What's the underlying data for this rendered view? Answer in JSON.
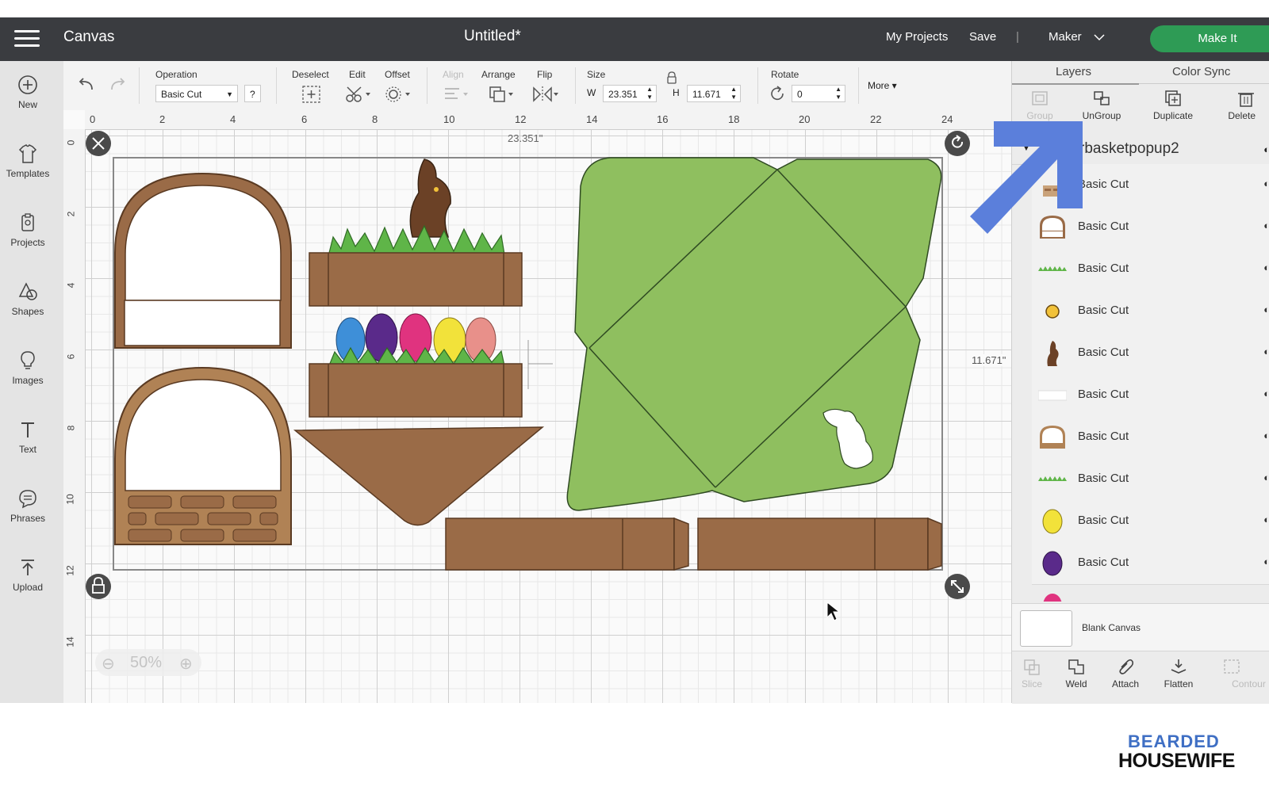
{
  "topbar": {
    "app_title": "Canvas",
    "doc_title": "Untitled*",
    "my_projects": "My Projects",
    "save": "Save",
    "separator": "|",
    "machine": "Maker",
    "make_it": "Make It"
  },
  "sidebar": {
    "items": [
      {
        "label": "New",
        "icon": "plus-circle-icon"
      },
      {
        "label": "Templates",
        "icon": "shirt-icon"
      },
      {
        "label": "Projects",
        "icon": "projects-icon"
      },
      {
        "label": "Shapes",
        "icon": "shapes-icon"
      },
      {
        "label": "Images",
        "icon": "lightbulb-icon"
      },
      {
        "label": "Text",
        "icon": "text-icon"
      },
      {
        "label": "Phrases",
        "icon": "speech-bubble-icon"
      },
      {
        "label": "Upload",
        "icon": "upload-icon"
      }
    ]
  },
  "toolbar": {
    "operation_label": "Operation",
    "operation_value": "Basic Cut",
    "help": "?",
    "deselect": "Deselect",
    "edit": "Edit",
    "offset": "Offset",
    "align": "Align",
    "arrange": "Arrange",
    "flip": "Flip",
    "size": "Size",
    "w_label": "W",
    "w_value": "23.351",
    "h_label": "H",
    "h_value": "11.671",
    "rotate": "Rotate",
    "rotate_value": "0",
    "more": "More ▾"
  },
  "canvas": {
    "ruler_top": [
      "0",
      "2",
      "4",
      "6",
      "8",
      "10",
      "12",
      "14",
      "16",
      "18",
      "20",
      "22",
      "24"
    ],
    "ruler_left": [
      "0",
      "2",
      "4",
      "6",
      "8",
      "10",
      "12",
      "14"
    ],
    "width_readout": "23.351\"",
    "height_readout": "11.671\"",
    "zoom": "50%",
    "colors": {
      "brown": "#9a6b47",
      "dark_brown": "#5a3a22",
      "tan": "#b08255",
      "green": "#8fbf5f",
      "grass": "#5fb548",
      "egg_blue": "#3e8fd8",
      "egg_purple": "#5a2a8a",
      "egg_pink": "#e0337f",
      "egg_yellow": "#f2e23a",
      "egg_salmon": "#e8908a"
    }
  },
  "panel": {
    "tab_layers": "Layers",
    "tab_color_sync": "Color Sync",
    "actions": [
      "Group",
      "UnGroup",
      "Duplicate",
      "Delete"
    ],
    "group_name": "rbasketpopup2",
    "layers": [
      {
        "label": "Basic Cut",
        "thumb": "basket-bricks"
      },
      {
        "label": "Basic Cut",
        "thumb": "basket-outline"
      },
      {
        "label": "Basic Cut",
        "thumb": "grass"
      },
      {
        "label": "Basic Cut",
        "thumb": "yellow-circle"
      },
      {
        "label": "Basic Cut",
        "thumb": "bunny"
      },
      {
        "label": "Basic Cut",
        "thumb": "white-rect"
      },
      {
        "label": "Basic Cut",
        "thumb": "basket-outline"
      },
      {
        "label": "Basic Cut",
        "thumb": "grass"
      },
      {
        "label": "Basic Cut",
        "thumb": "yellow-egg"
      },
      {
        "label": "Basic Cut",
        "thumb": "purple-egg"
      }
    ],
    "blank_canvas": "Blank Canvas",
    "bottom_actions": [
      "Slice",
      "Weld",
      "Attach",
      "Flatten",
      "Contour"
    ]
  },
  "watermark": {
    "line1": "BEARDED",
    "line2": "HOUSEWIFE"
  }
}
